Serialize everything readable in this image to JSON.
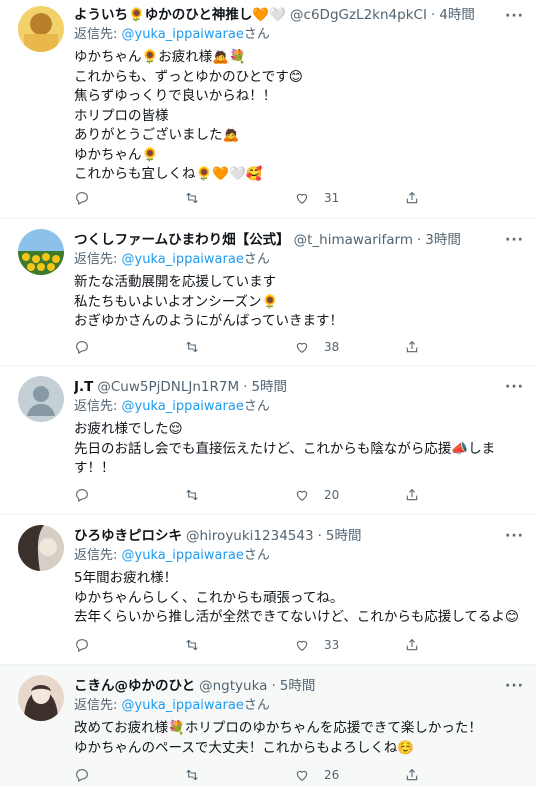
{
  "tweets": [
    {
      "name": "よういち🌻ゆかのひと神推し🧡🤍",
      "handle": "@c6DgGzL2kn4pkCI",
      "time": "4時間",
      "reply_prefix": "返信先: ",
      "reply_to": "@yuka_ippaiwarae",
      "reply_suffix": "さん",
      "body": "ゆかちゃん🌻お疲れ様🙇💐\nこれからも、ずっとゆかのひとです😊\n焦らずゆっくりで良いからね！！\nホリプロの皆様\nありがとうございました🙇\nゆかちゃん🌻\nこれからも宜しくね🌻🧡🤍🥰",
      "replies": "",
      "retweets": "",
      "likes": "31",
      "avatar_colors": [
        "#f2c93a",
        "#b8802a"
      ]
    },
    {
      "name": "つくしファームひまわり畑【公式】",
      "handle": "@t_himawarifarm",
      "time": "3時間",
      "reply_prefix": "返信先: ",
      "reply_to": "@yuka_ippaiwarae",
      "reply_suffix": "さん",
      "body": "新たな活動展開を応援しています\n私たちもいよいよオンシーズン🌻\nおぎゆかさんのようにがんばっていきます！",
      "replies": "",
      "retweets": "",
      "likes": "38",
      "avatar_colors": [
        "#6aa7d8",
        "#e3b620"
      ]
    },
    {
      "name": "J.T",
      "handle": "@Cuw5PjDNLJn1R7M",
      "time": "5時間",
      "reply_prefix": "返信先: ",
      "reply_to": "@yuka_ippaiwarae",
      "reply_suffix": "さん",
      "body": "お疲れ様でした😌\n先日のお話し会でも直接伝えたけど、これからも陰ながら応援📣しま\nす！！",
      "replies": "",
      "retweets": "",
      "likes": "20",
      "avatar_colors": [
        "#c4cfd6",
        "#8899a6"
      ]
    },
    {
      "name": "ひろゆきピロシキ",
      "handle": "@hiroyuki1234543",
      "time": "5時間",
      "reply_prefix": "返信先: ",
      "reply_to": "@yuka_ippaiwarae",
      "reply_suffix": "さん",
      "body": "5年間お疲れ様！\nゆかちゃんらしく、これからも頑張ってね。\n去年くらいから推し活が全然できてないけど、これからも応援してるよ😊",
      "replies": "",
      "retweets": "",
      "likes": "33",
      "avatar_colors": [
        "#5b5048",
        "#d6cfc6"
      ]
    },
    {
      "name": "こきん@ゆかのひと",
      "handle": "@ngtyuka",
      "time": "5時間",
      "reply_prefix": "返信先: ",
      "reply_to": "@yuka_ippaiwarae",
      "reply_suffix": "さん",
      "body": "改めてお疲れ様💐ホリプロのゆかちゃんを応援できて楽しかった！\nゆかちゃんのペースで大丈夫！これからもよろしくね☺️",
      "replies": "",
      "retweets": "",
      "likes": "26",
      "avatar_colors": [
        "#3c2f2c",
        "#e8d8cc"
      ]
    }
  ],
  "more_icon": "more-horizontal-icon",
  "action_icons": [
    "reply-icon",
    "retweet-icon",
    "like-icon",
    "share-icon"
  ],
  "colors": {
    "link": "#1d9bf0",
    "muted": "#536471",
    "divider": "#eff3f4"
  }
}
